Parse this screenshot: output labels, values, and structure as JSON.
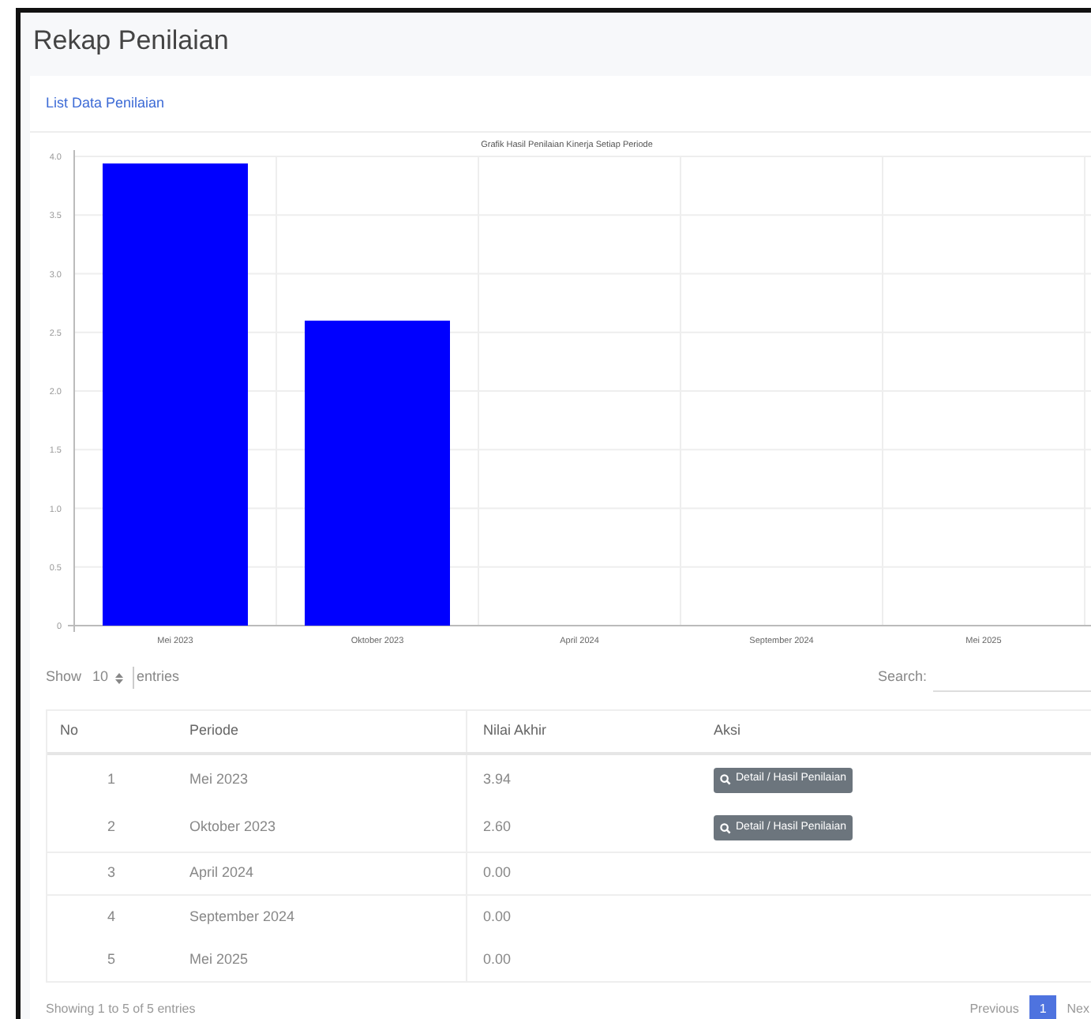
{
  "page_title": "Rekap Penilaian",
  "card_title": "List Data Penilaian",
  "chart": {
    "chart_data": {
      "type": "bar",
      "title": "Grafik Hasil Penilaian Kinerja Setiap Periode",
      "categories": [
        "Mei 2023",
        "Oktober 2023",
        "April 2024",
        "September 2024",
        "Mei 2025"
      ],
      "series": [
        {
          "color": "#0000ff",
          "values": [
            3.94,
            2.6,
            0,
            0,
            0
          ]
        }
      ],
      "grid": true,
      "ylim": [
        0,
        4
      ],
      "yticks": [
        0,
        {
          "value": 0.5,
          "label": "0.5"
        },
        {
          "value": 1,
          "label": "1.0"
        },
        {
          "value": 1.5,
          "label": "1.5"
        },
        {
          "value": 2,
          "label": "2.0"
        },
        {
          "value": 2.5,
          "label": "2.5"
        },
        {
          "value": 3,
          "label": "3.0"
        },
        {
          "value": 3.5,
          "label": "3.5"
        },
        {
          "value": 4,
          "label": "4.0"
        }
      ]
    }
  },
  "length_menu": {
    "prefix": "Show",
    "value": "10",
    "suffix": "entries"
  },
  "search": {
    "label": "Search:"
  },
  "table": {
    "columns": [
      "No",
      "Periode",
      "Nilai Akhir",
      "Aksi"
    ],
    "rows": [
      {
        "no": "1",
        "periode": "Mei 2023",
        "nilai": "3.94",
        "action": "Detail / Hasil Penilaian"
      },
      {
        "no": "2",
        "periode": "Oktober 2023",
        "nilai": "2.60",
        "action": "Detail / Hasil Penilaian"
      },
      {
        "no": "3",
        "periode": "April 2024",
        "nilai": "0.00"
      },
      {
        "no": "4",
        "periode": "September 2024",
        "nilai": "0.00"
      },
      {
        "no": "5",
        "periode": "Mei 2025",
        "nilai": "0.00"
      }
    ]
  },
  "info": "Showing 1 to 5 of 5 entries",
  "pagination": [
    {
      "label": "Previous",
      "selected": false
    },
    {
      "label": "1",
      "selected": true
    },
    {
      "label": "Nex",
      "selected": false
    }
  ]
}
